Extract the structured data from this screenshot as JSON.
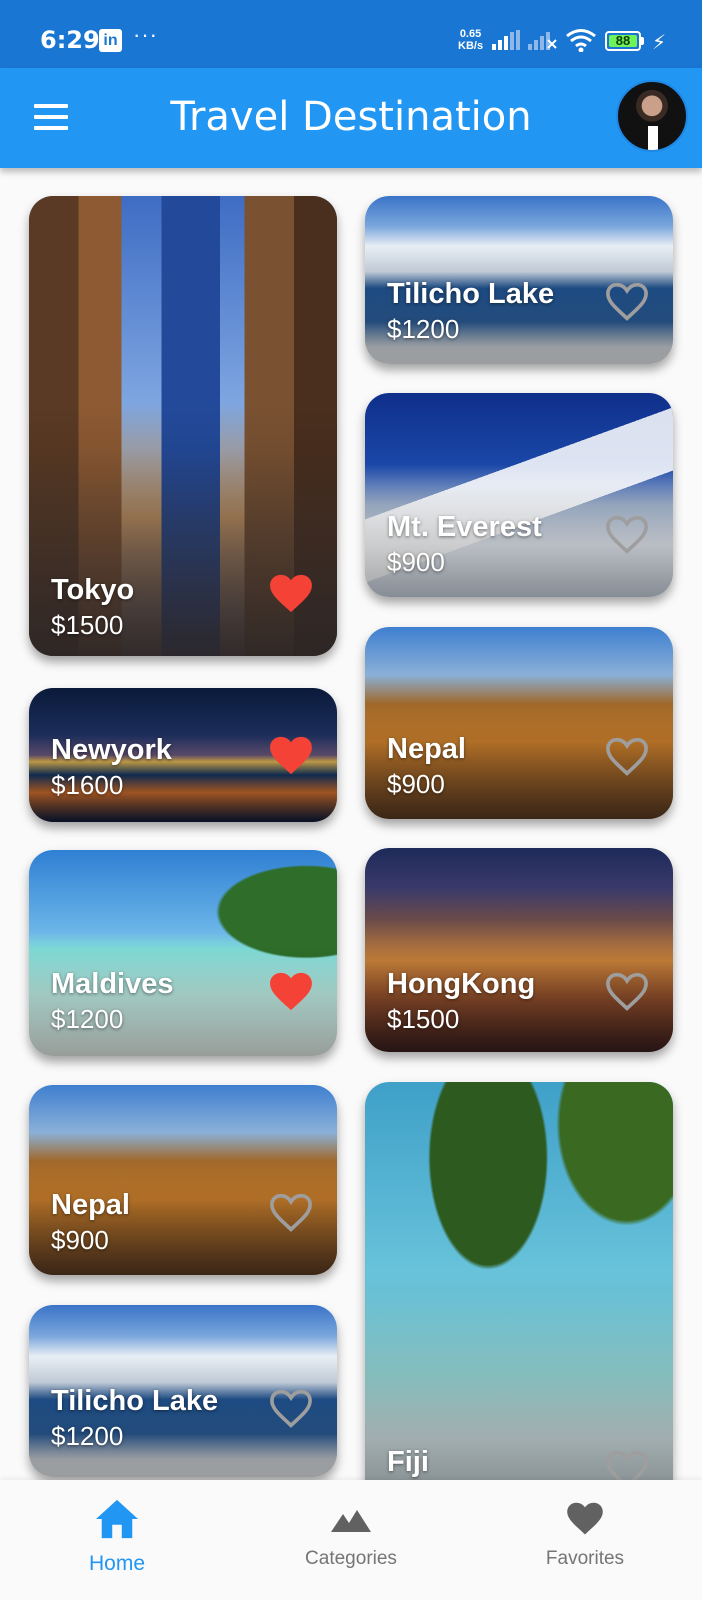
{
  "status_bar": {
    "time": "6:29",
    "app_badge": "in",
    "dots": "···",
    "net_speed_value": "0.65",
    "net_speed_unit": "KB/s",
    "battery": "88"
  },
  "app_bar": {
    "title": "Travel Destination"
  },
  "colors": {
    "status_bar": "#1976d2",
    "app_bar": "#2196f3",
    "favorite_active": "#f44336",
    "nav_active": "#2196f3",
    "nav_inactive": "#757575"
  },
  "destinations": [
    {
      "name": "Tokyo",
      "price": "$1500",
      "favorite": true
    },
    {
      "name": "Tilicho Lake",
      "price": "$1200",
      "favorite": false
    },
    {
      "name": "Mt. Everest",
      "price": "$900",
      "favorite": false
    },
    {
      "name": "Newyork",
      "price": "$1600",
      "favorite": true
    },
    {
      "name": "Nepal",
      "price": "$900",
      "favorite": false
    },
    {
      "name": "Maldives",
      "price": "$1200",
      "favorite": true
    },
    {
      "name": "HongKong",
      "price": "$1500",
      "favorite": false
    },
    {
      "name": "Nepal",
      "price": "$900",
      "favorite": false
    },
    {
      "name": "Fiji",
      "price": "",
      "favorite": false
    },
    {
      "name": "Tilicho Lake",
      "price": "$1200",
      "favorite": false
    }
  ],
  "bottom_nav": {
    "items": [
      {
        "label": "Home",
        "icon": "home-icon",
        "active": true
      },
      {
        "label": "Categories",
        "icon": "mountain-icon",
        "active": false
      },
      {
        "label": "Favorites",
        "icon": "heart-icon",
        "active": false
      }
    ]
  }
}
